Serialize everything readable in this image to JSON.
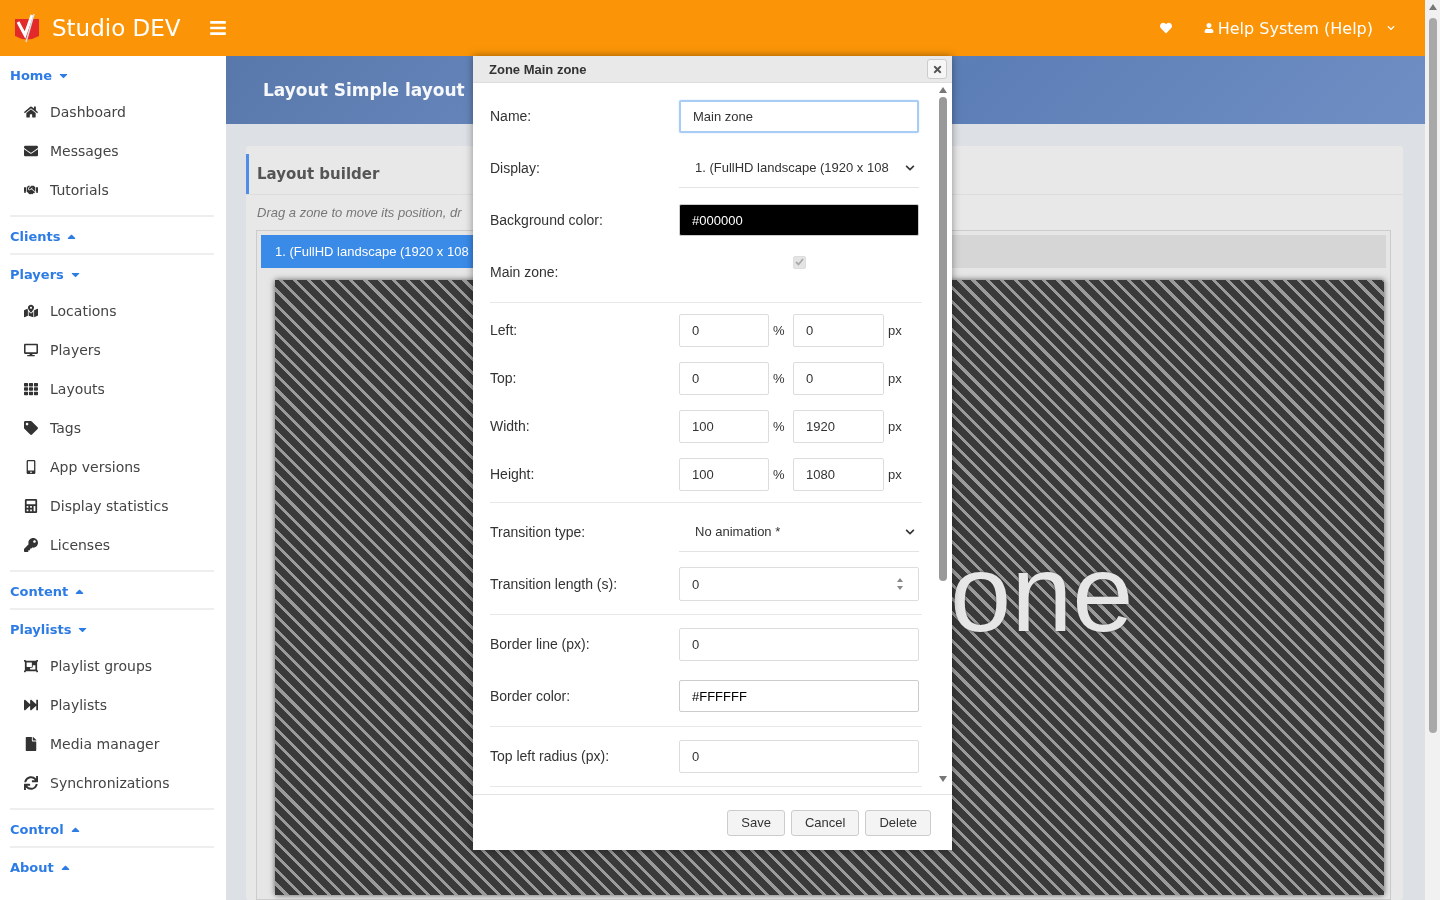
{
  "header": {
    "brand": "Studio DEV",
    "user": "Help System (Help)"
  },
  "sidebar": [
    {
      "title": "Home",
      "expanded": true,
      "items": [
        {
          "label": "Dashboard"
        },
        {
          "label": "Messages"
        },
        {
          "label": "Tutorials"
        }
      ]
    },
    {
      "title": "Clients",
      "expanded": false
    },
    {
      "title": "Players",
      "expanded": true,
      "items": [
        {
          "label": "Locations"
        },
        {
          "label": "Players"
        },
        {
          "label": "Layouts"
        },
        {
          "label": "Tags"
        },
        {
          "label": "App versions"
        },
        {
          "label": "Display statistics"
        },
        {
          "label": "Licenses"
        }
      ]
    },
    {
      "title": "Content",
      "expanded": false
    },
    {
      "title": "Playlists",
      "expanded": true,
      "items": [
        {
          "label": "Playlist groups"
        },
        {
          "label": "Playlists"
        },
        {
          "label": "Media manager"
        },
        {
          "label": "Synchronizations"
        }
      ]
    },
    {
      "title": "Control",
      "expanded": false
    },
    {
      "title": "About",
      "expanded": false
    }
  ],
  "page": {
    "title": "Layout Simple layout",
    "card_title": "Layout builder",
    "hint": "Drag a zone to move its position, dr",
    "display_tab": "1. (FullHD landscape (1920 x 108",
    "zone_text": "one"
  },
  "dialog": {
    "title": "Zone Main zone",
    "groups": [
      [
        {
          "kind": "text",
          "label": "Name:",
          "value": "Main zone",
          "focused": true
        },
        {
          "kind": "select",
          "label": "Display:",
          "value": "1. (FullHD landscape (1920 x 108"
        },
        {
          "kind": "color",
          "label": "Background color:",
          "value": "#000000",
          "color": "#000000"
        },
        {
          "kind": "checkbox",
          "label": "Main zone:",
          "checked": true,
          "disabled": true
        }
      ],
      [
        {
          "kind": "dual",
          "label": "Left:",
          "percent": "0",
          "pct_unit": "%",
          "pixels": "0",
          "px_unit": "px"
        },
        {
          "kind": "dual",
          "label": "Top:",
          "percent": "0",
          "pct_unit": "%",
          "pixels": "0",
          "px_unit": "px"
        },
        {
          "kind": "dual",
          "label": "Width:",
          "percent": "100",
          "pct_unit": "%",
          "pixels": "1920",
          "px_unit": "px"
        },
        {
          "kind": "dual",
          "label": "Height:",
          "percent": "100",
          "pct_unit": "%",
          "pixels": "1080",
          "px_unit": "px"
        }
      ],
      [
        {
          "kind": "select",
          "label": "Transition type:",
          "value": "No animation *"
        },
        {
          "kind": "number",
          "label": "Transition length (s):",
          "value": "0"
        }
      ],
      [
        {
          "kind": "text",
          "label": "Border line (px):",
          "value": "0",
          "focused": false
        },
        {
          "kind": "color",
          "label": "Border color:",
          "value": "#FFFFFF",
          "color": "#ffffff"
        }
      ],
      [
        {
          "kind": "text",
          "label": "Top left radius (px):",
          "value": "0",
          "focused": false
        }
      ]
    ],
    "buttons": [
      "Save",
      "Cancel",
      "Delete"
    ]
  }
}
